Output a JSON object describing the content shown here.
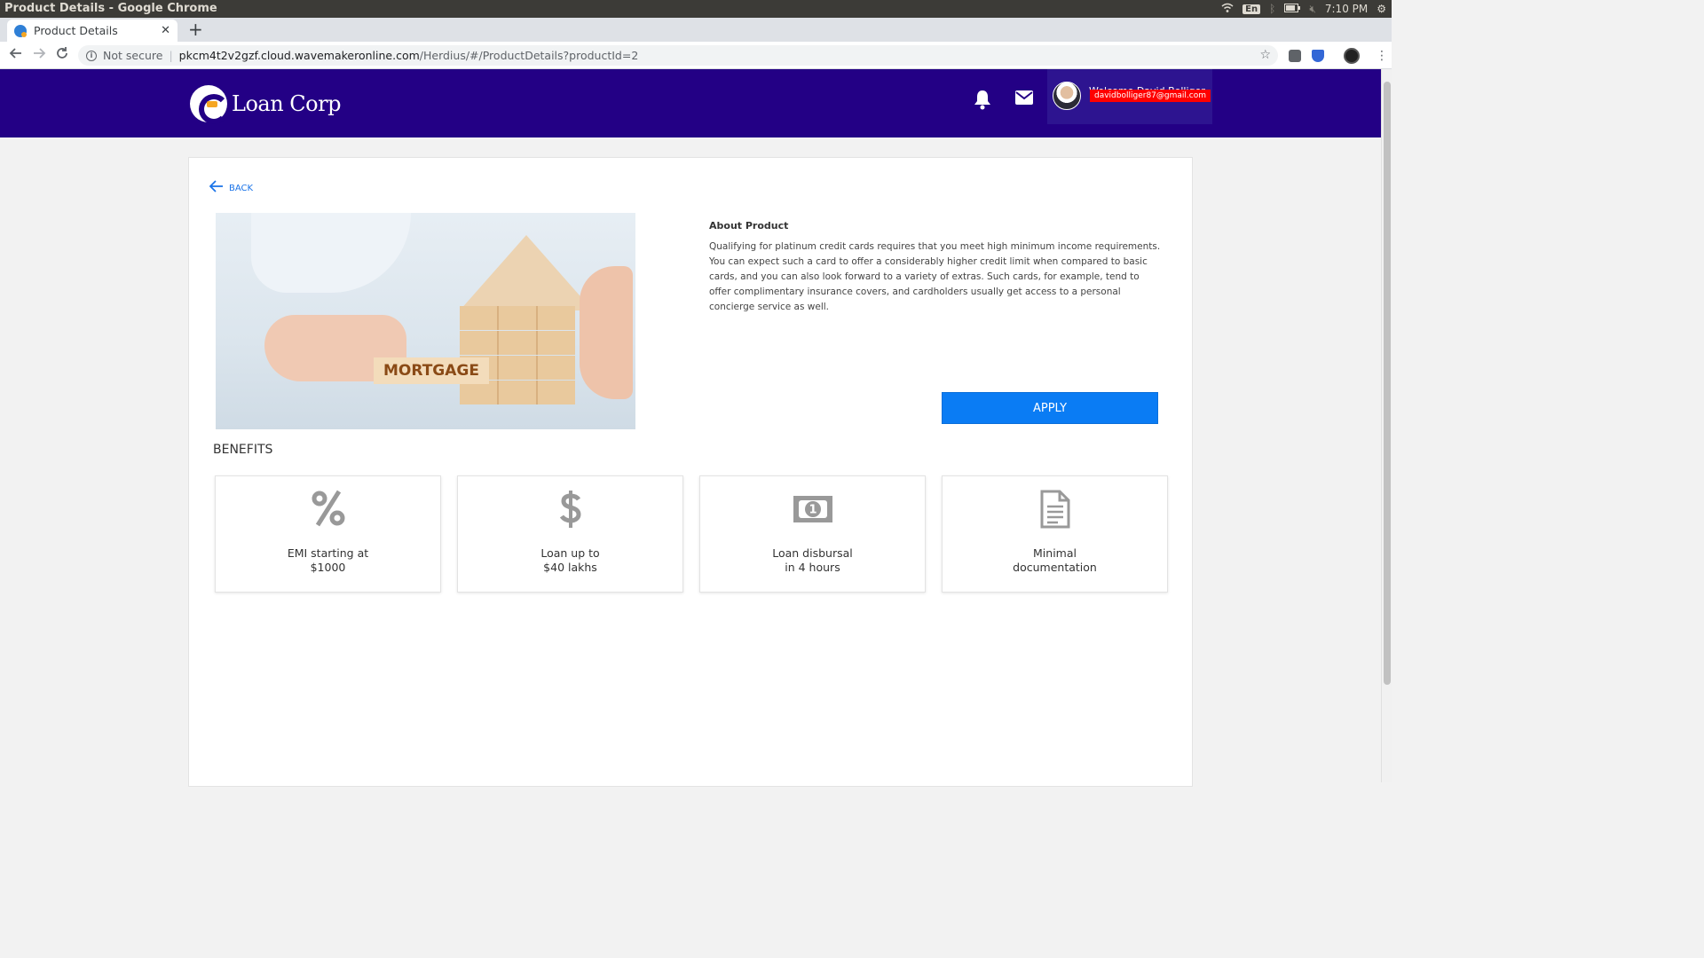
{
  "os": {
    "window_title": "Product Details - Google Chrome",
    "keyboard": "En",
    "clock": "7:10 PM"
  },
  "browser": {
    "tab_title": "Product Details",
    "not_secure": "Not secure",
    "url_host": "pkcm4t2v2gzf.cloud.wavemakeronline.com",
    "url_path": "/Herdius/#/ProductDetails?productId=2"
  },
  "header": {
    "brand": "Loan Corp",
    "user_welcome": "Welcome David Bolliger",
    "user_email": "davidbolliger87@gmail.com",
    "colors": {
      "header_bg": "#230085",
      "accent": "#0a7cf4"
    }
  },
  "product": {
    "back_label": "BACK",
    "image_tag": "MORTGAGE",
    "about_title": "About Product",
    "about_text": "Qualifying for platinum credit cards requires that you meet high minimum income requirements. You can expect such a card to offer a considerably higher credit limit when compared to basic cards, and you can also look forward to a variety of extras. Such cards, for example, tend to offer complimentary insurance covers, and cardholders usually get access to a personal concierge service as well.",
    "apply_label": "APPLY"
  },
  "benefits": {
    "title": "BENEFITS",
    "items": [
      {
        "icon": "percent-icon",
        "line1": "EMI starting at",
        "line2": "$1000"
      },
      {
        "icon": "dollar-icon",
        "line1": "Loan up to",
        "line2": "$40 lakhs"
      },
      {
        "icon": "money-bill-icon",
        "line1": "Loan disbursal",
        "line2": "in 4 hours"
      },
      {
        "icon": "document-icon",
        "line1": "Minimal",
        "line2": "documentation"
      }
    ]
  }
}
